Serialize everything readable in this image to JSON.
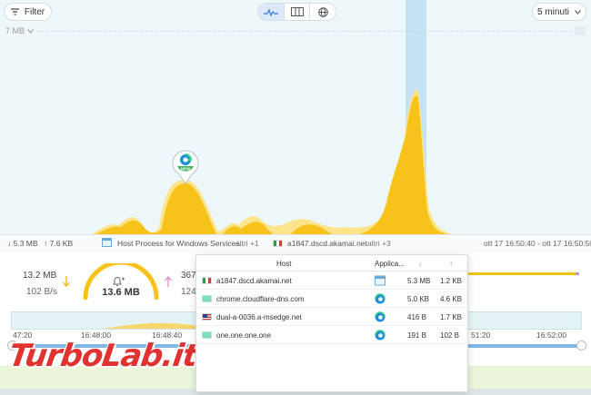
{
  "toolbar": {
    "filter_label": "Filter",
    "time_range": "5 minuti",
    "views": [
      "timeline-icon",
      "columns-icon",
      "globe-icon"
    ]
  },
  "graph": {
    "y_max_label": "7 MB",
    "marker_badge": "NEW",
    "colors": {
      "traffic": "#f7c31b",
      "traffic_light": "#fbe48c",
      "selection": "#a8d2eb"
    }
  },
  "status": {
    "down": "↓ 5.3 MB",
    "up": "↑ 7.6 KB",
    "process": "Host Process for Windows Services",
    "process_extra": "altri +1",
    "host": "a1847.dscd.akamai.net",
    "host_extra": "altri +3",
    "range": "ott 17 16:50:40 - ott 17 16:50:50"
  },
  "stats": {
    "left_total": "13.2 MB",
    "left_rate": "102 B/s",
    "gauge_value": "13.6 MB",
    "right_total": "367",
    "right_rate": "124"
  },
  "timeline": {
    "labels": [
      "47:20",
      "16:48:00",
      "16:48:40",
      "51:20",
      "16:52:00"
    ]
  },
  "popup": {
    "headers": {
      "host": "Host",
      "app": "Applica...",
      "down": "↓",
      "up": "↑"
    },
    "rows": [
      {
        "flag": "it",
        "host": "a1847.dscd.akamai.net",
        "app_icon": "window-icon",
        "down": "5.3 MB",
        "up": "1.2 KB"
      },
      {
        "flag": "un",
        "host": "chrome.cloudflare-dns.com",
        "app_icon": "edge-icon",
        "down": "5.0 KB",
        "up": "4.6 KB"
      },
      {
        "flag": "us",
        "host": "dual-a-0036.a-msedge.net",
        "app_icon": "edge-icon",
        "down": "416 B",
        "up": "1.7 KB"
      },
      {
        "flag": "un",
        "host": "one.one.one.one",
        "app_icon": "edge-icon",
        "down": "191 B",
        "up": "102 B"
      }
    ]
  },
  "watermark": {
    "text": "TurboLab.it"
  }
}
